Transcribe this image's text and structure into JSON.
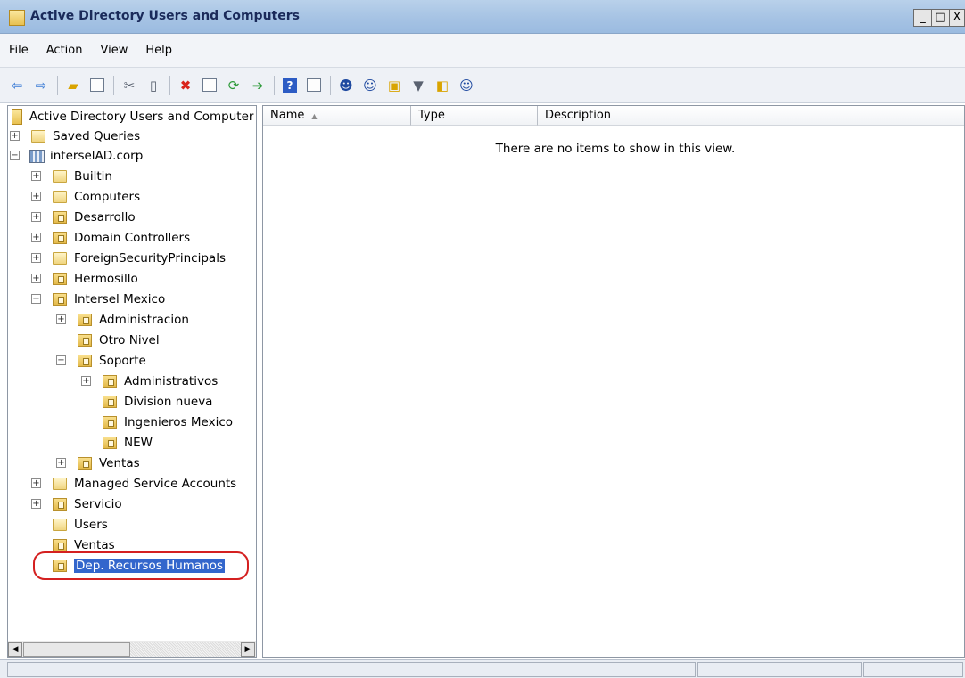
{
  "window": {
    "title": "Active Directory Users and Computers",
    "buttons": {
      "minimize": "_",
      "maximize": "□",
      "close": "X"
    }
  },
  "menu": {
    "items": [
      "File",
      "Action",
      "View",
      "Help"
    ]
  },
  "toolbar": {
    "icons": [
      "back-arrow-icon",
      "forward-arrow-icon",
      "up-folder-icon",
      "show-hide-tree-icon",
      "cut-icon",
      "clipboard-icon",
      "delete-icon",
      "properties-icon",
      "refresh-icon",
      "export-list-icon",
      "help-icon",
      "console-tree-icon",
      "new-user-icon",
      "new-group-icon",
      "new-ou-icon",
      "filter-icon",
      "add-to-group-icon",
      "delegate-icon"
    ]
  },
  "tree": {
    "root": "Active Directory Users and Computer",
    "items": [
      {
        "label": "Saved Queries",
        "icon": "folder",
        "expander": "+"
      },
      {
        "label": "interselAD.corp",
        "icon": "domain",
        "expander": "−"
      },
      {
        "label": "Builtin",
        "icon": "folder",
        "expander": "+"
      },
      {
        "label": "Computers",
        "icon": "folder",
        "expander": "+"
      },
      {
        "label": "Desarrollo",
        "icon": "ou",
        "expander": "+"
      },
      {
        "label": "Domain Controllers",
        "icon": "ou",
        "expander": "+"
      },
      {
        "label": "ForeignSecurityPrincipals",
        "icon": "folder",
        "expander": "+"
      },
      {
        "label": "Hermosillo",
        "icon": "ou",
        "expander": "+"
      },
      {
        "label": "Intersel Mexico",
        "icon": "ou",
        "expander": "−"
      },
      {
        "label": "Administracion",
        "icon": "ou",
        "expander": "+"
      },
      {
        "label": "Otro Nivel",
        "icon": "ou",
        "expander": ""
      },
      {
        "label": "Soporte",
        "icon": "ou",
        "expander": "−"
      },
      {
        "label": "Administrativos",
        "icon": "ou",
        "expander": "+"
      },
      {
        "label": "Division nueva",
        "icon": "ou",
        "expander": ""
      },
      {
        "label": "Ingenieros Mexico",
        "icon": "ou",
        "expander": ""
      },
      {
        "label": "NEW",
        "icon": "ou",
        "expander": ""
      },
      {
        "label": "Ventas",
        "icon": "ou",
        "expander": "+"
      },
      {
        "label": "Managed Service Accounts",
        "icon": "folder",
        "expander": "+"
      },
      {
        "label": "Servicio",
        "icon": "ou",
        "expander": "+"
      },
      {
        "label": "Users",
        "icon": "folder",
        "expander": ""
      },
      {
        "label": "Ventas",
        "icon": "ou",
        "expander": ""
      },
      {
        "label": "Dep. Recursos Humanos",
        "icon": "ou",
        "expander": "",
        "selected": true
      }
    ]
  },
  "list": {
    "columns": [
      "Name",
      "Type",
      "Description"
    ],
    "sort_indicator": "▲",
    "empty_message": "There are no items to show in this view."
  },
  "colors": {
    "selection": "#3366cc",
    "highlight_ring": "#d42020",
    "titlebar": "#a6c3e4"
  }
}
